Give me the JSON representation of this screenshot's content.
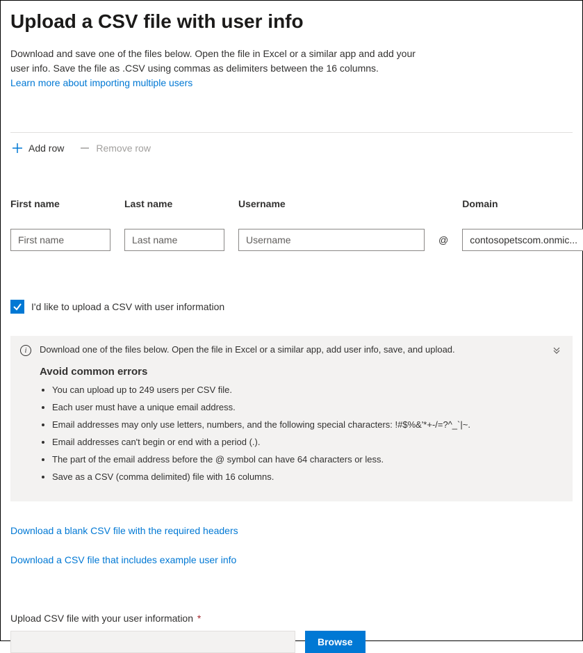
{
  "header": {
    "title": "Upload a CSV file with user info",
    "description_l1": "Download and save one of the files below. Open the file in Excel or a similar app and add your",
    "description_l2": "user info. Save the file as .CSV using commas as delimiters between the 16 columns.",
    "learn_link": "Learn more about importing multiple users"
  },
  "toolbar": {
    "add_label": "Add row",
    "remove_label": "Remove row"
  },
  "form": {
    "first_label": "First name",
    "first_placeholder": "First name",
    "last_label": "Last name",
    "last_placeholder": "Last name",
    "user_label": "Username",
    "user_placeholder": "Username",
    "at": "@",
    "domain_label": "Domain",
    "domain_value": "contosopetscom.onmic..."
  },
  "checkbox": {
    "label": "I'd like to upload a CSV with user information",
    "checked": true
  },
  "info": {
    "lead": "Download one of the files below. Open the file in Excel or a similar app, add user info, save, and upload.",
    "avoid_title": "Avoid common errors",
    "items": [
      "You can upload up to 249 users per CSV file.",
      "Each user must have a unique email address.",
      "Email addresses may only use letters, numbers, and the following special characters: !#$%&'*+-/=?^_`|~.",
      "Email addresses can't begin or end with a period (.).",
      "The part of the email address before the @ symbol can have 64 characters or less.",
      "Save as a CSV (comma delimited) file with 16 columns."
    ]
  },
  "downloads": {
    "blank": "Download a blank CSV file with the required headers",
    "example": "Download a CSV file that includes example user info"
  },
  "upload": {
    "label": "Upload CSV file with your user information",
    "required": "*",
    "browse": "Browse"
  }
}
